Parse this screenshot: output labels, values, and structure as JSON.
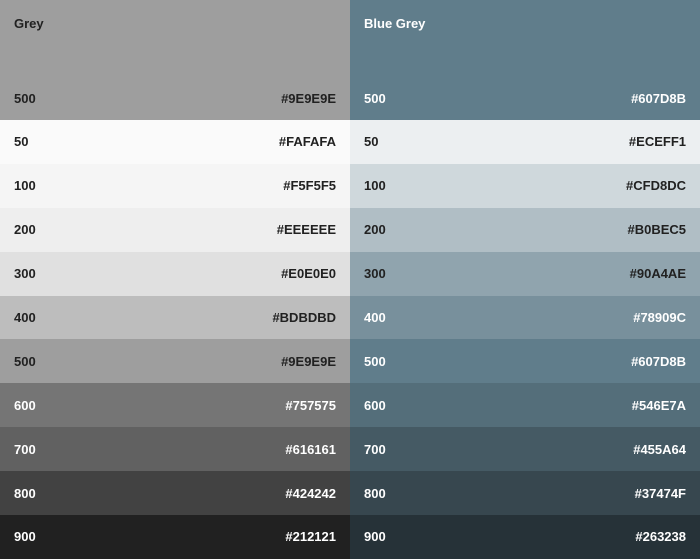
{
  "palettes": [
    {
      "name": "Grey",
      "header": {
        "shade": "500",
        "hex": "#9E9E9E",
        "color": "#9E9E9E",
        "text": "light"
      },
      "swatches": [
        {
          "shade": "50",
          "hex": "#FAFAFA",
          "color": "#FAFAFA",
          "text": "light"
        },
        {
          "shade": "100",
          "hex": "#F5F5F5",
          "color": "#F5F5F5",
          "text": "light"
        },
        {
          "shade": "200",
          "hex": "#EEEEEE",
          "color": "#EEEEEE",
          "text": "light"
        },
        {
          "shade": "300",
          "hex": "#E0E0E0",
          "color": "#E0E0E0",
          "text": "light"
        },
        {
          "shade": "400",
          "hex": "#BDBDBD",
          "color": "#BDBDBD",
          "text": "light"
        },
        {
          "shade": "500",
          "hex": "#9E9E9E",
          "color": "#9E9E9E",
          "text": "light"
        },
        {
          "shade": "600",
          "hex": "#757575",
          "color": "#757575",
          "text": "dark"
        },
        {
          "shade": "700",
          "hex": "#616161",
          "color": "#616161",
          "text": "dark"
        },
        {
          "shade": "800",
          "hex": "#424242",
          "color": "#424242",
          "text": "dark"
        },
        {
          "shade": "900",
          "hex": "#212121",
          "color": "#212121",
          "text": "dark"
        }
      ]
    },
    {
      "name": "Blue Grey",
      "header": {
        "shade": "500",
        "hex": "#607D8B",
        "color": "#607D8B",
        "text": "dark"
      },
      "swatches": [
        {
          "shade": "50",
          "hex": "#ECEFF1",
          "color": "#ECEFF1",
          "text": "light"
        },
        {
          "shade": "100",
          "hex": "#CFD8DC",
          "color": "#CFD8DC",
          "text": "light"
        },
        {
          "shade": "200",
          "hex": "#B0BEC5",
          "color": "#B0BEC5",
          "text": "light"
        },
        {
          "shade": "300",
          "hex": "#90A4AE",
          "color": "#90A4AE",
          "text": "light"
        },
        {
          "shade": "400",
          "hex": "#78909C",
          "color": "#78909C",
          "text": "dark"
        },
        {
          "shade": "500",
          "hex": "#607D8B",
          "color": "#607D8B",
          "text": "dark"
        },
        {
          "shade": "600",
          "hex": "#546E7A",
          "color": "#546E7A",
          "text": "dark"
        },
        {
          "shade": "700",
          "hex": "#455A64",
          "color": "#455A64",
          "text": "dark"
        },
        {
          "shade": "800",
          "hex": "#37474F",
          "color": "#37474F",
          "text": "dark"
        },
        {
          "shade": "900",
          "hex": "#263238",
          "color": "#263238",
          "text": "dark"
        }
      ]
    }
  ]
}
